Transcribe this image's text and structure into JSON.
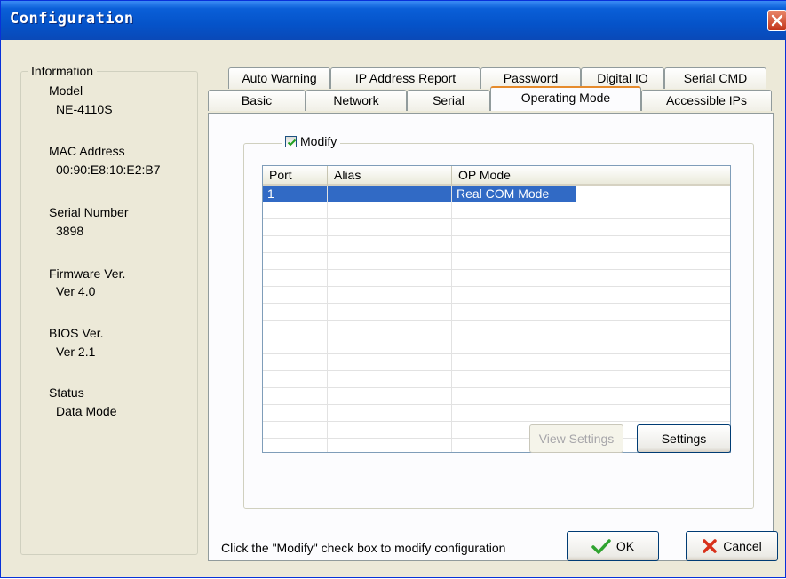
{
  "window": {
    "title": "Configuration"
  },
  "info": {
    "legend": "Information",
    "fields": [
      {
        "label": "Model",
        "value": "NE-4110S"
      },
      {
        "label": "MAC Address",
        "value": "00:90:E8:10:E2:B7"
      },
      {
        "label": "Serial Number",
        "value": "3898"
      },
      {
        "label": "Firmware Ver.",
        "value": "Ver 4.0"
      },
      {
        "label": "BIOS Ver.",
        "value": "Ver 2.1"
      },
      {
        "label": "Status",
        "value": "Data Mode"
      }
    ]
  },
  "tabs": {
    "row1": [
      "Auto Warning",
      "IP Address Report",
      "Password",
      "Digital IO",
      "Serial CMD"
    ],
    "row2": [
      "Basic",
      "Network",
      "Serial",
      "Operating Mode",
      "Accessible IPs"
    ],
    "active": "Operating Mode"
  },
  "modify": {
    "label": "Modify",
    "checked": true
  },
  "grid": {
    "columns": [
      "Port",
      "Alias",
      "OP Mode",
      ""
    ],
    "rows": [
      {
        "port": "1",
        "alias": "",
        "op_mode": "Real COM Mode",
        "selected": true
      }
    ]
  },
  "buttons": {
    "view_settings": "View Settings",
    "settings": "Settings",
    "ok": "OK",
    "cancel": "Cancel"
  },
  "hint": "Click the \"Modify\" check box to modify configuration",
  "colors": {
    "titlebar": "#0553c9",
    "selection": "#316ac5",
    "ok_icon": "#2fa32f",
    "cancel_icon": "#d8311b"
  }
}
